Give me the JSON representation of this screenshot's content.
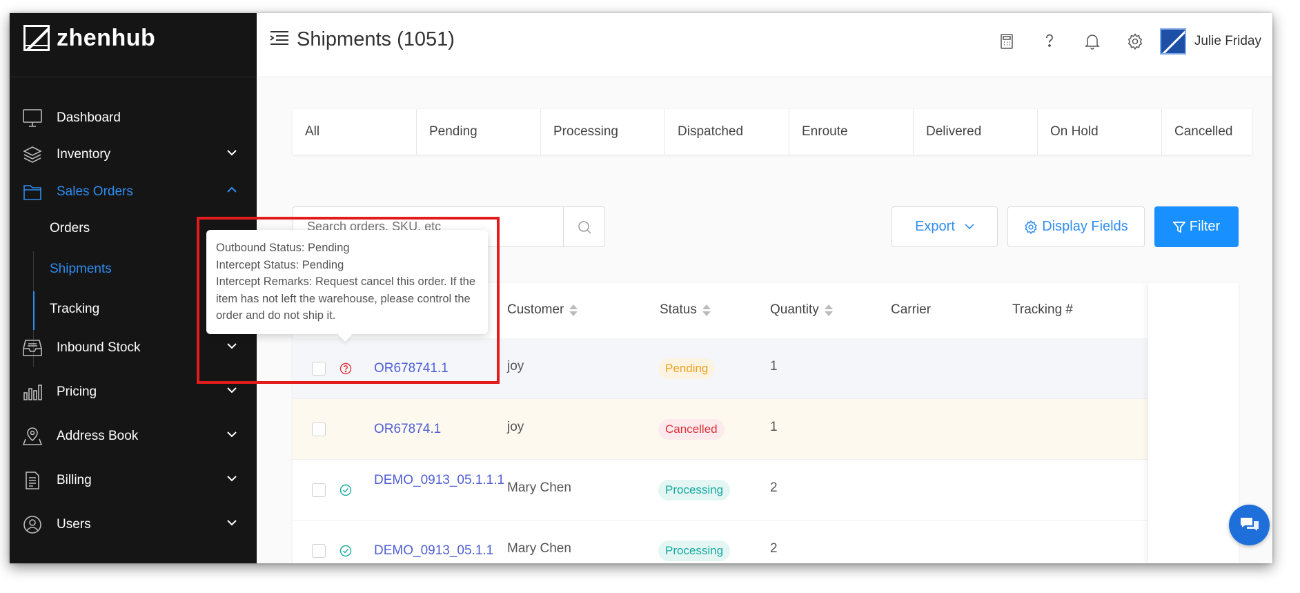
{
  "app": {
    "logo_text": "zhenhub"
  },
  "header": {
    "title": "Shipments (1051)",
    "user_name": "Julie Friday"
  },
  "sidebar": {
    "items": [
      {
        "label": "Dashboard",
        "icon": "monitor-icon"
      },
      {
        "label": "Inventory",
        "icon": "layers-icon"
      },
      {
        "label": "Sales Orders",
        "icon": "folder-icon"
      },
      {
        "label": "Inbound Stock",
        "icon": "inbox-icon"
      },
      {
        "label": "Pricing",
        "icon": "bar-chart-icon"
      },
      {
        "label": "Address Book",
        "icon": "map-pin-icon"
      },
      {
        "label": "Billing",
        "icon": "document-icon"
      },
      {
        "label": "Users",
        "icon": "user-icon"
      }
    ],
    "sales_sub": [
      "Orders",
      "Shipments",
      "Tracking"
    ]
  },
  "tabs": [
    "All",
    "Pending",
    "Processing",
    "Dispatched",
    "Enroute",
    "Delivered",
    "On Hold",
    "Cancelled"
  ],
  "search": {
    "placeholder": "Search orders, SKU, etc"
  },
  "toolbar": {
    "export_label": "Export",
    "display_fields_label": "Display Fields",
    "filter_label": "Filter"
  },
  "table": {
    "columns": {
      "customer": "Customer",
      "status": "Status",
      "quantity": "Quantity",
      "carrier": "Carrier",
      "tracking": "Tracking #"
    },
    "rows": [
      {
        "order": "OR678741.1",
        "customer": "joy",
        "status": "Pending",
        "quantity": "1",
        "icon": "question-circle-icon"
      },
      {
        "order": "OR67874.1",
        "customer": "joy",
        "status": "Cancelled",
        "quantity": "1",
        "icon": ""
      },
      {
        "order": "DEMO_0913_05.1.1.1",
        "customer": "Mary Chen",
        "status": "Processing",
        "quantity": "2",
        "icon": "check-circle-icon"
      },
      {
        "order": "DEMO_0913_05.1.1",
        "customer": "Mary Chen",
        "status": "Processing",
        "quantity": "2",
        "icon": "check-circle-icon"
      }
    ]
  },
  "tooltip": {
    "line1": "Outbound Status: Pending",
    "line2": "Intercept Status: Pending",
    "line3": "Intercept Remarks: Request cancel this order. If the item has not left the warehouse, please control the order and do not ship it."
  },
  "colors": {
    "accent": "#2f8df0",
    "link": "#4f5fd4",
    "pending": "#f0a020",
    "cancelled": "#e0303a",
    "processing": "#13a89e",
    "highlight": "#e31b1b"
  }
}
